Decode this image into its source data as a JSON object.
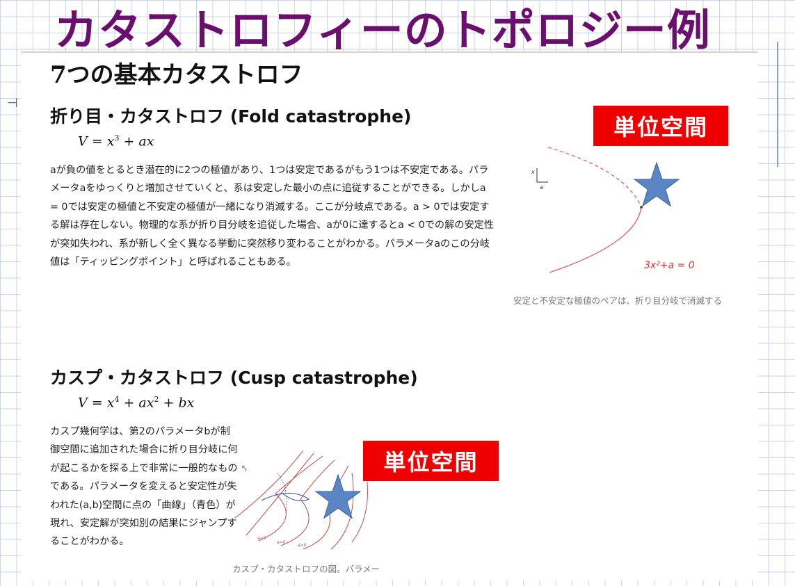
{
  "slide": {
    "title": "カタストロフィーのトポロジー例"
  },
  "document": {
    "main_heading": "7つの基本カタストロフ",
    "fold": {
      "heading": "折り目・カタストロフ (Fold catastrophe)",
      "formula_lhs": "V = x",
      "formula_exp": "3",
      "formula_rhs": " + ax",
      "body": "aが負の値をとるとき潜在的に2つの極値があり、1つは安定であるがもう1つは不安定である。パラメータaをゆっくりと増加させていくと、系は安定した最小の点に追従することができる。しかしa = 0では安定の極値と不安定の極値が一緒になり消滅する。ここが分岐点である。a > 0では安定する解は存在しない。物理的な系が折り目分岐を追従した場合、aが0に達するとa < 0での解の安定性が突如失われ、系が新しく全く異なる挙動に突然移り変わることがわかる。パラメータaのこの分岐値は「ティッピングポイント」と呼ばれることもある。",
      "figure_label": "3x²+a = 0",
      "axis_x": "a",
      "axis_y": "x",
      "caption": "安定と不安定な極値のペアは、折り目分岐で消滅する"
    },
    "cusp": {
      "heading": "カスプ・カタストロフ (Cusp catastrophe)",
      "formula_a": "V = x",
      "formula_exp1": "4",
      "formula_b": " + ax",
      "formula_exp2": "2",
      "formula_c": " + bx",
      "body": "カスプ幾何学は、第2のパラメータbが制御空間に追加された場合に折り目分岐に何が起こるかを探る上で非常に一般的なものである。パラメータを変えると安定性が失われた(a,b)空間に点の「曲線」（青色）が現れ、安定解が突如別の結果にジャンプすることがわかる。",
      "fig_labels": [
        "a<0",
        "a=0",
        "a>0"
      ],
      "caption": "カスプ・カタストロフの図。パラメー"
    }
  },
  "annotations": {
    "box1": "単位空間",
    "box2": "単位空間",
    "accent_red": "#ee0000",
    "title_color": "#6a0f6c",
    "star_color": "#5b86c5"
  }
}
